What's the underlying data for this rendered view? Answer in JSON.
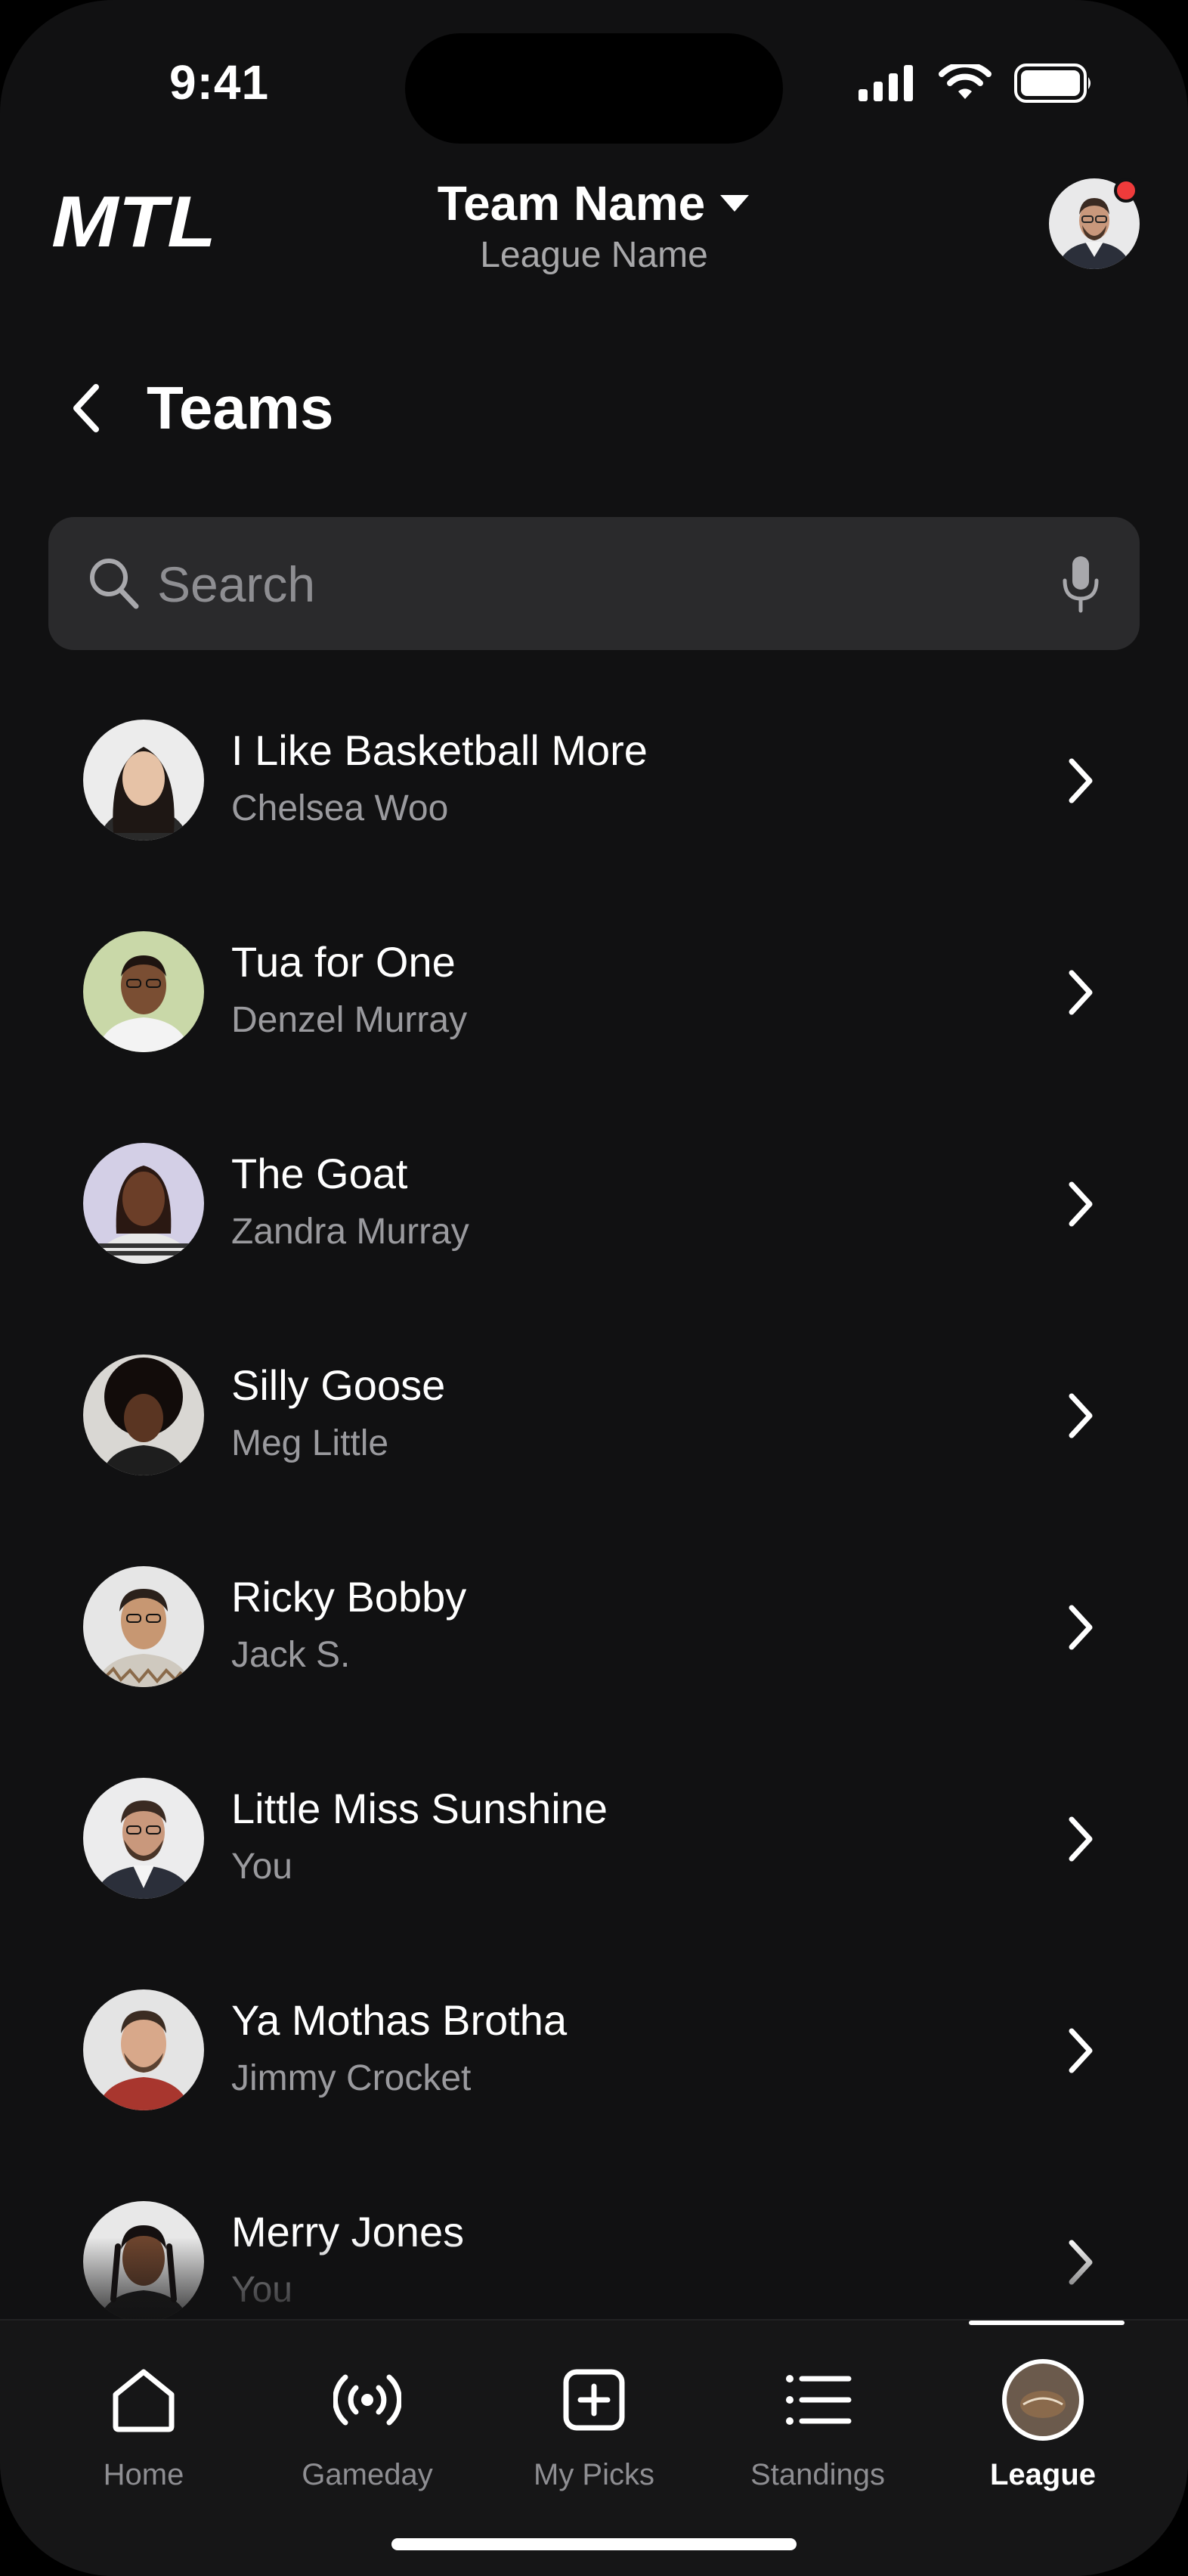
{
  "status_bar": {
    "time": "9:41"
  },
  "header": {
    "logo_text": "MTL",
    "team_name": "Team Name",
    "league_name": "League Name"
  },
  "page": {
    "title": "Teams"
  },
  "search": {
    "placeholder": "Search"
  },
  "teams": [
    {
      "name": "I Like Basketball More",
      "owner": "Chelsea Woo"
    },
    {
      "name": "Tua for One",
      "owner": "Denzel Murray"
    },
    {
      "name": "The Goat",
      "owner": "Zandra Murray"
    },
    {
      "name": "Silly Goose",
      "owner": "Meg Little"
    },
    {
      "name": "Ricky Bobby",
      "owner": "Jack S."
    },
    {
      "name": "Little Miss Sunshine",
      "owner": "You"
    },
    {
      "name": "Ya Mothas Brotha",
      "owner": "Jimmy Crocket"
    },
    {
      "name": "Merry Jones",
      "owner": "You"
    }
  ],
  "tabs": [
    {
      "label": "Home",
      "icon": "home-icon"
    },
    {
      "label": "Gameday",
      "icon": "broadcast-icon"
    },
    {
      "label": "My Picks",
      "icon": "plus-square-icon"
    },
    {
      "label": "Standings",
      "icon": "list-icon"
    },
    {
      "label": "League",
      "icon": "league-avatar-icon",
      "active": true
    }
  ],
  "colors": {
    "background": "#111112",
    "search_bg": "#2a2a2c",
    "notification": "#ef3b3b",
    "secondary_text": "#9a9a9e"
  }
}
